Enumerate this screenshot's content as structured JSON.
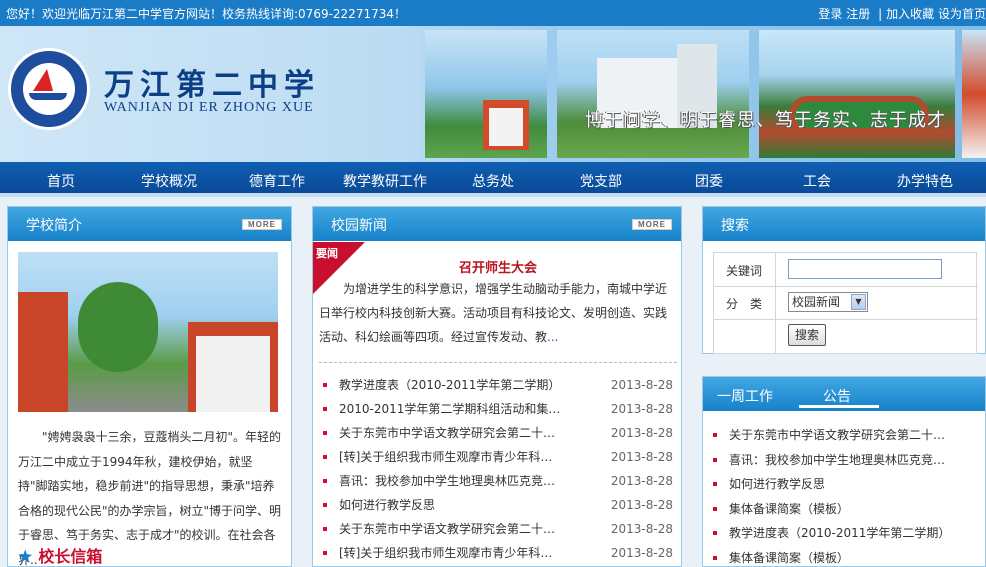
{
  "topbar": {
    "welcome": "您好！欢迎光临万江第二中学官方网站！校务热线详询:0769-22271734！",
    "login": "登录",
    "register": "注册",
    "sep": "|",
    "add_favorite": "加入收藏",
    "set_homepage": "设为首页"
  },
  "banner": {
    "logo_text": "WANJIANG DI ER ZHONG XUE",
    "school_name": "万江第二中学",
    "school_pinyin": "WANJIAN DI ER ZHONG XUE",
    "motto": "博于问学、明于睿思、笃于务实、志于成才"
  },
  "nav": {
    "items": [
      "首页",
      "学校概况",
      "德育工作",
      "教学教研工作",
      "总务处",
      "党支部",
      "团委",
      "工会",
      "办学特色"
    ]
  },
  "left_panel": {
    "title": "学校简介",
    "more": "MORE",
    "intro": "\"娉娉袅袅十三余，豆蔻梢头二月初\"。年轻的万江二中成立于1994年秋，建校伊始，就坚持\"脚踏实地，稳步前进\"的指导思想，秉承\"培养合格的现代公民\"的办学宗旨，树立\"博于问学、明于睿思、笃于务实、志于成才\"的校训。在社会各界..",
    "principal_mailbox": "校长信箱"
  },
  "middle_panel": {
    "title": "校园新闻",
    "more": "MORE",
    "ribbon": "要闻",
    "headline": "召开师生大会",
    "lead": "为增进学生的科学意识，增强学生动脑动手能力，南城中学近日举行校内科技创新大赛。活动项目有科技论文、发明创造、实践活动、科幻绘画等四项。经过宣传发动、教",
    "lead_more": "...",
    "news": [
      {
        "title": "教学进度表（2010-2011学年第二学期）",
        "date": "2013-8-28"
      },
      {
        "title": "2010-2011学年第二学期科组活动和集…",
        "date": "2013-8-28"
      },
      {
        "title": "关于东莞市中学语文教学研究会第二十…",
        "date": "2013-8-28"
      },
      {
        "title": "[转]关于组织我市师生观摩市青少年科…",
        "date": "2013-8-28"
      },
      {
        "title": "喜讯：我校参加中学生地理奥林匹克竞…",
        "date": "2013-8-28"
      },
      {
        "title": "如何进行教学反思",
        "date": "2013-8-28"
      },
      {
        "title": "关于东莞市中学语文教学研究会第二十…",
        "date": "2013-8-28"
      },
      {
        "title": "[转]关于组织我市师生观摩市青少年科…",
        "date": "2013-8-28"
      }
    ]
  },
  "search_panel": {
    "title": "搜索",
    "keyword_label": "关键词",
    "keyword_value": "",
    "category_label": "分　类",
    "category_selected": "校园新闻",
    "search_button": "搜索"
  },
  "notice_panel": {
    "tab_week": "一周工作",
    "tab_notice": "公告",
    "items": [
      "关于东莞市中学语文教学研究会第二十…",
      "喜讯：我校参加中学生地理奥林匹克竞…",
      "如何进行教学反思",
      "集体备课简案（模板）",
      "教学进度表（2010-2011学年第二学期）",
      "集体备课简案（模板）"
    ]
  },
  "colors": {
    "topbar": "#1a7bc7",
    "nav": "#0a4a97",
    "panel_head": "#1782ca",
    "accent_red": "#c8102e"
  }
}
